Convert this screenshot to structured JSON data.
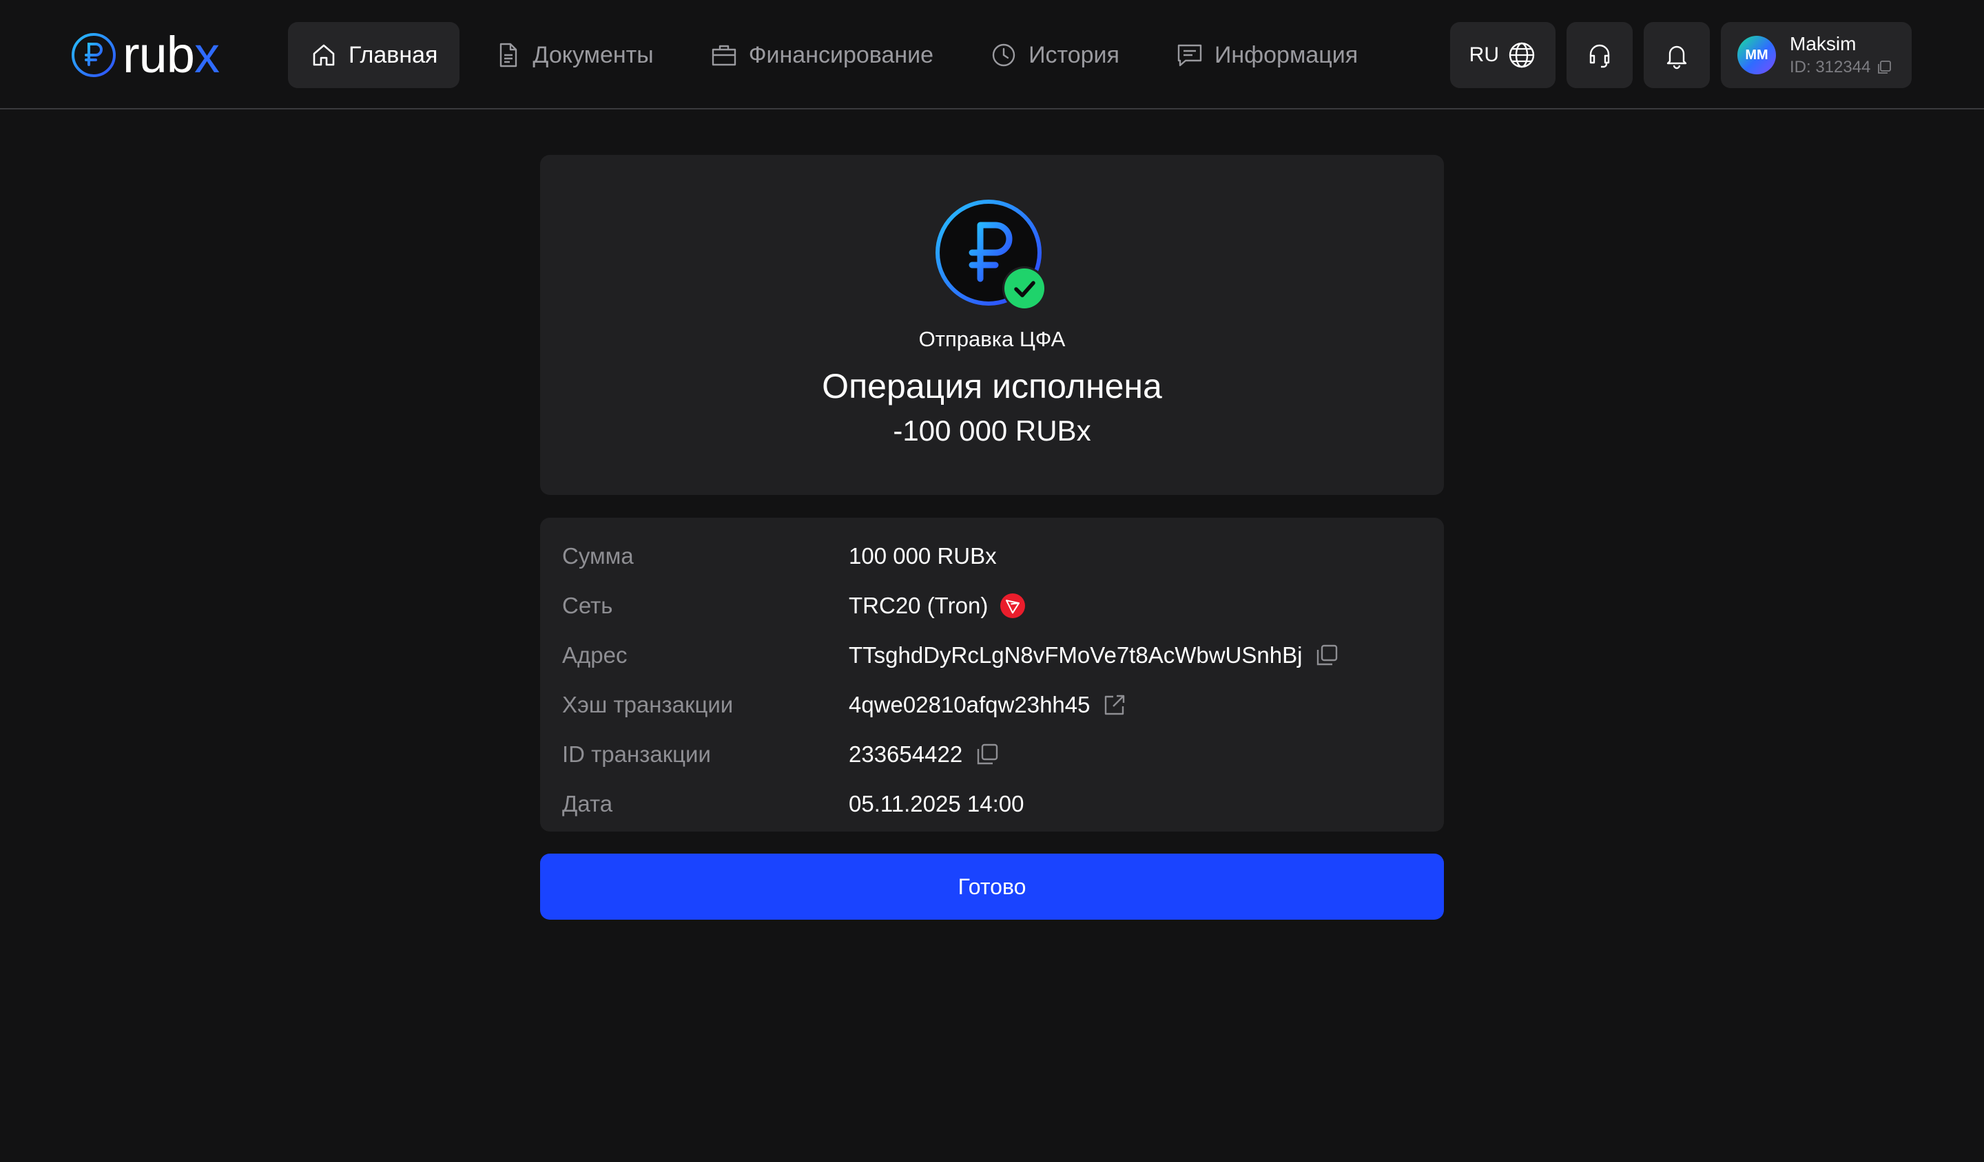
{
  "brand": {
    "logo_text_main": "rub",
    "logo_text_accent": "x",
    "accent_color": "#2f6bff"
  },
  "nav": {
    "items": [
      {
        "label": "Главная",
        "icon": "home-icon",
        "active": true
      },
      {
        "label": "Документы",
        "icon": "document-icon",
        "active": false
      },
      {
        "label": "Финансирование",
        "icon": "briefcase-icon",
        "active": false
      },
      {
        "label": "История",
        "icon": "clock-icon",
        "active": false
      },
      {
        "label": "Информация",
        "icon": "chat-icon",
        "active": false
      }
    ]
  },
  "header": {
    "language": "RU",
    "user": {
      "initials": "MM",
      "name": "Maksim",
      "id_label": "ID: 312344"
    }
  },
  "operation": {
    "type": "Отправка ЦФА",
    "status": "Операция исполнена",
    "amount": "-100 000 RUBx",
    "status_color": "#1fd36b"
  },
  "details": {
    "rows": [
      {
        "label": "Сумма",
        "value": "100 000 RUBx"
      },
      {
        "label": "Сеть",
        "value": "TRC20 (Tron)"
      },
      {
        "label": "Адрес",
        "value": "TTsghdDyRcLgN8vFMoVe7t8AcWbwUSnhBj"
      },
      {
        "label": "Хэш транзакции",
        "value": "4qwe02810afqw23hh45"
      },
      {
        "label": "ID транзакции",
        "value": "233654422"
      },
      {
        "label": "Дата",
        "value": "05.11.2025 14:00"
      }
    ]
  },
  "actions": {
    "done_label": "Готово",
    "done_color": "#1a44ff"
  }
}
